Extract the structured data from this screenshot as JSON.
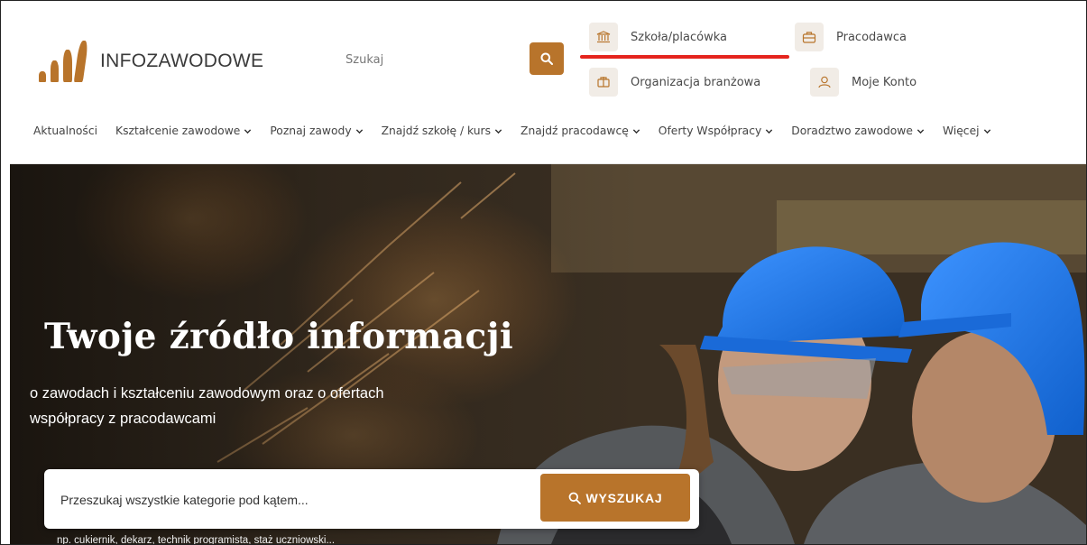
{
  "header": {
    "logo_text": "INFOZAWODOWE",
    "search_placeholder": "Szukaj",
    "quick_links": {
      "school": "Szkoła/placówka",
      "employer": "Pracodawca",
      "organization": "Organizacja branżowa",
      "account": "Moje Konto"
    }
  },
  "nav": {
    "items": [
      {
        "label": "Aktualności",
        "dropdown": false
      },
      {
        "label": "Kształcenie zawodowe",
        "dropdown": true
      },
      {
        "label": "Poznaj zawody",
        "dropdown": true
      },
      {
        "label": "Znajdź szkołę / kurs",
        "dropdown": true
      },
      {
        "label": "Znajdź pracodawcę",
        "dropdown": true
      },
      {
        "label": "Oferty Współpracy",
        "dropdown": true
      },
      {
        "label": "Doradztwo zawodowe",
        "dropdown": true
      },
      {
        "label": "Więcej",
        "dropdown": true
      }
    ]
  },
  "hero": {
    "title": "Twoje źródło informacji",
    "subtitle": "o zawodach i kształceniu zawodowym oraz o ofertach współpracy z pracodawcami",
    "search_placeholder": "Przeszukaj wszystkie kategorie pod kątem...",
    "search_button": "WYSZUKAJ",
    "hint": "np. cukiernik, dekarz, technik programista, staż uczniowski..."
  },
  "colors": {
    "accent": "#b8742b",
    "active_underline": "#e5241d",
    "helmet": "#1e78e6"
  }
}
